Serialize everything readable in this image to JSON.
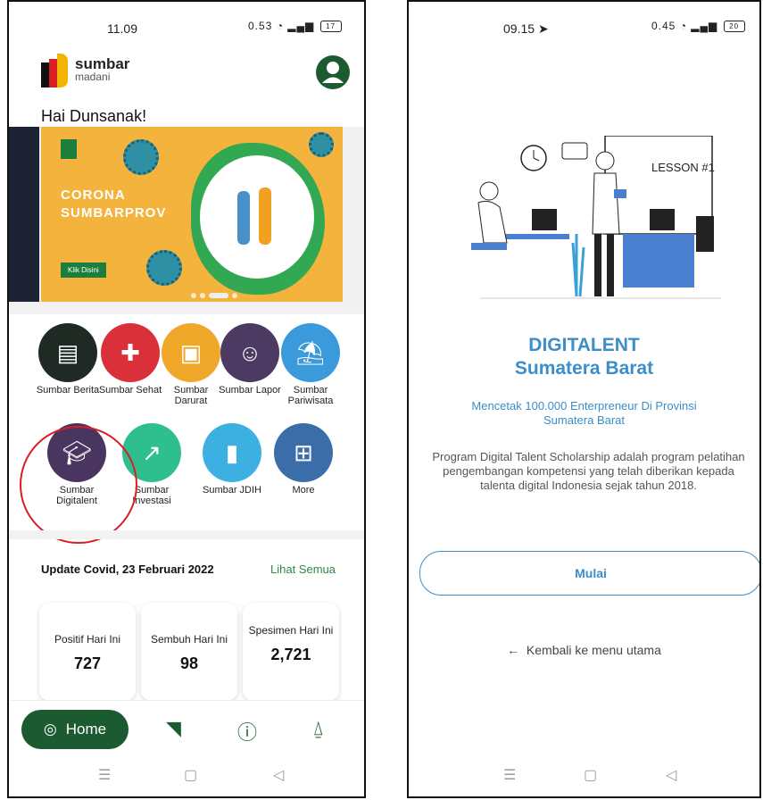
{
  "left": {
    "status": {
      "time": "11.09",
      "speed": "0.53",
      "battery": "17"
    },
    "logo": {
      "line1": "sumbar",
      "line2": "madani"
    },
    "greeting": "Hai Dunsanak!",
    "banner": {
      "title1": "CORONA",
      "title2": "SUMBARPROV",
      "button": "Klik Disini"
    },
    "menu": [
      {
        "label": "Sumbar Berita",
        "icon": "news-icon",
        "color": "#1f2a24"
      },
      {
        "label": "Sumbar Sehat",
        "icon": "health-cross-icon",
        "color": "#d9303a"
      },
      {
        "label": "Sumbar Darurat",
        "icon": "bus-icon",
        "color": "#f0a82a"
      },
      {
        "label": "Sumbar Lapor",
        "icon": "chat-face-icon",
        "color": "#4c3a63"
      },
      {
        "label": "Sumbar Pariwisata",
        "icon": "island-icon",
        "color": "#3b9ad9"
      },
      {
        "label": "Sumbar Digitalent",
        "icon": "graduation-cap-icon",
        "color": "#4a3560"
      },
      {
        "label": "Sumbar Investasi",
        "icon": "trend-icon",
        "color": "#2fbf8f"
      },
      {
        "label": "Sumbar JDIH",
        "icon": "book-icon",
        "color": "#3cb0e0"
      },
      {
        "label": "More",
        "icon": "grid-icon",
        "color": "#3b6ea8"
      }
    ],
    "update_title": "Update Covid, 23 Februari 2022",
    "see_all": "Lihat Semua",
    "stats": [
      {
        "label": "Positif Hari Ini",
        "value": "727"
      },
      {
        "label": "Sembuh Hari Ini",
        "value": "98"
      },
      {
        "label": "Spesimen Hari Ini",
        "value": "2,721"
      }
    ],
    "nav": {
      "home": "Home"
    }
  },
  "right": {
    "status": {
      "time": "09.15",
      "speed": "0.45",
      "battery": "20"
    },
    "lesson": "LESSON #1",
    "title1": "DIGITALENT",
    "title2": "Sumatera Barat",
    "subtitle": "Mencetak 100.000 Enterpreneur Di Provinsi Sumatera Barat",
    "description": "Program Digital Talent Scholarship adalah program pelatihan pengembangan kompetensi yang telah diberikan kepada talenta digital Indonesia sejak tahun 2018.",
    "start_button": "Mulai",
    "back_link": "Kembali ke menu utama"
  }
}
